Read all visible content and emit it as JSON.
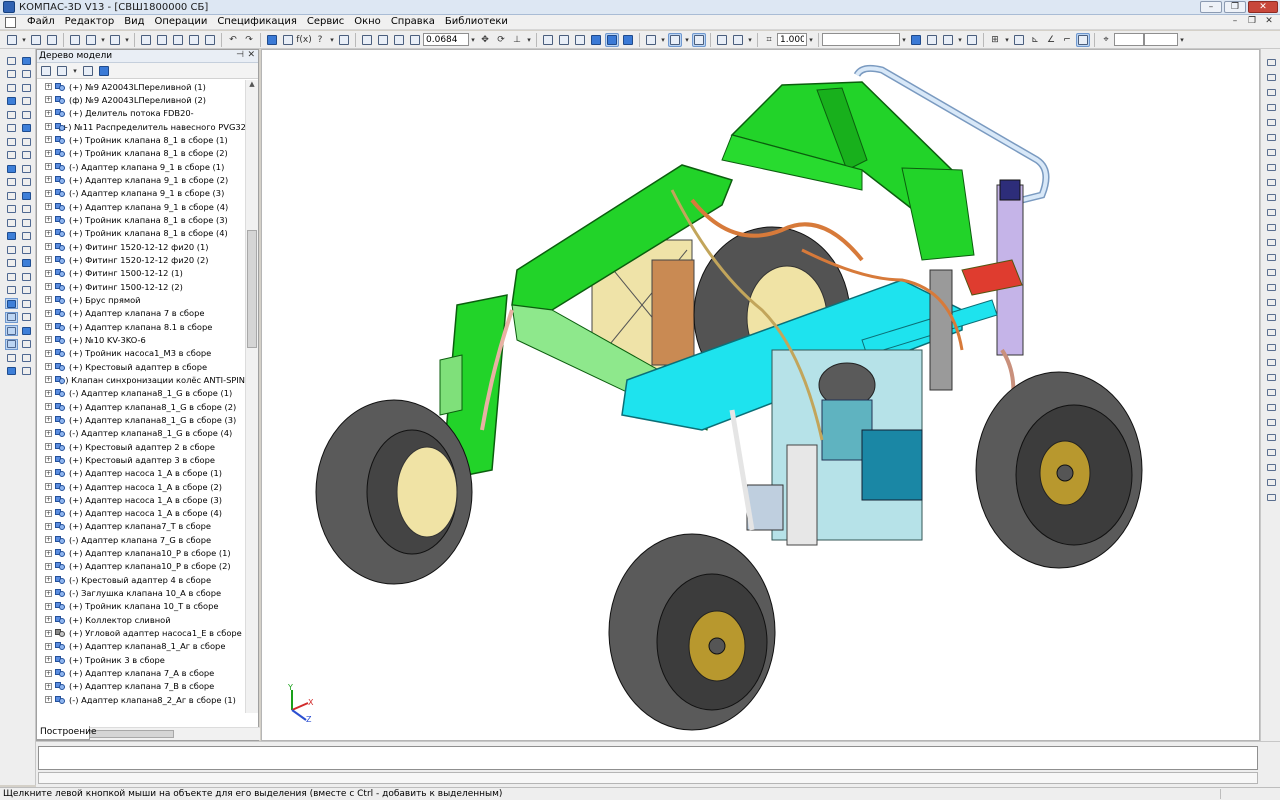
{
  "window": {
    "title": "КОМПАС-3D V13 - [СВШ1800000 СБ]"
  },
  "menu": {
    "items": [
      "Файл",
      "Редактор",
      "Вид",
      "Операции",
      "Спецификация",
      "Сервис",
      "Окно",
      "Справка",
      "Библиотеки"
    ]
  },
  "toolbar": {
    "zoom_value": "0.0684",
    "scale_value": "1.000"
  },
  "tree_panel": {
    "title": "Дерево модели",
    "tab_label": "Построение",
    "items": [
      "(+) №9 A20043LПереливной (1)",
      "(ф) №9 A20043LПереливной (2)",
      "(+) Делитель потока FDB20-",
      "(+) №11 Распределитель навесного PVG32",
      "(+) Тройник клапана 8_1 в сборе (1)",
      "(+) Тройник клапана 8_1 в сборе (2)",
      "(-) Адаптер клапана 9_1 в сборе (1)",
      "(+) Адаптер клапана 9_1 в сборе (2)",
      "(-) Адаптер клапана 9_1 в сборе (3)",
      "(+) Адаптер клапана 9_1 в сборе (4)",
      "(+) Тройник клапана 8_1 в сборе (3)",
      "(+) Тройник клапана 8_1 в сборе (4)",
      "(+) Фитинг 1520-12-12 фи20 (1)",
      "(+) Фитинг 1520-12-12 фи20 (2)",
      "(+) Фитинг 1500-12-12 (1)",
      "(+) Фитинг 1500-12-12 (2)",
      "(+) Брус прямой",
      "(+) Адаптер клапана 7 в сборе",
      "(+) Адаптер клапана 8.1 в сборе",
      "(+) №10 KV-3KO-6",
      "(+) Тройник насоса1_М3 в сборе",
      "(+) Крестовый адаптер в сборе",
      "(-) Клапан синхронизации колёс ANTI-SPIN",
      "(-) Адаптер клапана8_1_G в сборе (1)",
      "(+) Адаптер клапана8_1_G в сборе (2)",
      "(+) Адаптер клапана8_1_G в сборе (3)",
      "(-) Адаптер клапана8_1_G в сборе (4)",
      "(+) Крестовый адаптер 2 в сборе",
      "(+) Крестовый адаптер 3 в сборе",
      "(+) Адаптер насоса 1_А в сборе (1)",
      "(+) Адаптер насоса 1_А в сборе (2)",
      "(+) Адаптер насоса 1_А в сборе (3)",
      "(+) Адаптер насоса 1_А в сборе (4)",
      "(+) Адаптер клапана7_Т в сборе",
      "(-) Адаптер клапана 7_G в сборе",
      "(+) Адаптер клапана10_Р в сборе (1)",
      "(+) Адаптер клапана10_Р в сборе (2)",
      "(-) Крестовый адаптер 4 в сборе",
      "(-) Заглушка клапана 10_А в сборе",
      "(+) Тройник клапана 10_Т в сборе",
      "(+) Коллектор сливной",
      "(+) Угловой адаптер насоса1_Е в сборе",
      "(+) Адаптер клапана8_1_Аг в сборе",
      "(+) Тройник 3 в сборе",
      "(+) Адаптер клапана 7_А в сборе",
      "(+) Адаптер клапана 7_В в сборе",
      "(-) Адаптер клапана8_2_Аг в сборе (1)"
    ]
  },
  "viewport": {
    "triad": {
      "x_label": "X",
      "y_label": "Y",
      "z_label": "Z"
    }
  },
  "status": {
    "hint": "Щелкните левой кнопкой мыши на объекте для его выделения (вместе с Ctrl - добавить к выделенным)"
  },
  "colors": {
    "frame_green": "#22d329",
    "frame_cyan": "#1ee3ee",
    "tire_gray": "#5a5a5a",
    "hub_gold": "#b8982e",
    "accent_blue": "#3b7ad6"
  }
}
